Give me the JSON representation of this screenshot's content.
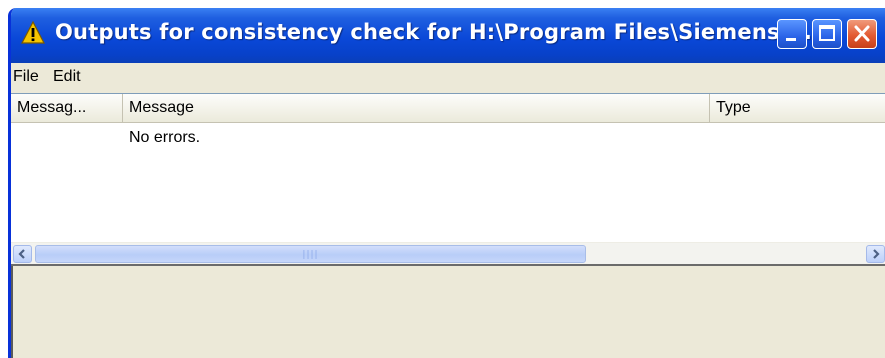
{
  "window": {
    "title": "Outputs for consistency check for  H:\\Program Files\\Siemens\\...",
    "icon": "warning-icon",
    "buttons": [
      "minimize-icon",
      "maximize-icon",
      "close-icon"
    ],
    "colors": {
      "titlebar": "#0a48d8",
      "close": "#e35b33",
      "window_bg": "#ece9d8",
      "warning": "#f5c400"
    }
  },
  "menu": {
    "file": "File",
    "edit": "Edit"
  },
  "list": {
    "columns": [
      "Messag...",
      "Message",
      "Type"
    ],
    "rows": [
      {
        "col1": "",
        "message": "No errors.",
        "type": ""
      }
    ]
  },
  "scrollbar": {
    "left_icon": "chevron-left-icon",
    "right_icon": "chevron-right-icon"
  }
}
